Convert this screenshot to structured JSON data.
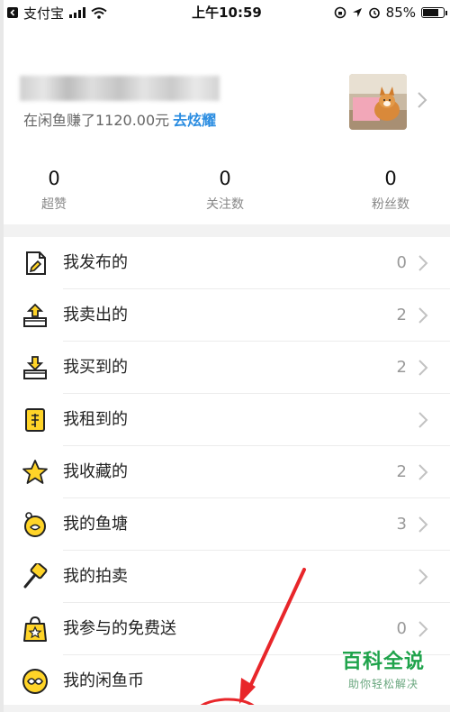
{
  "status_bar": {
    "app_back": "支付宝",
    "time": "上午10:59",
    "battery": "85%",
    "battery_level": 0.85
  },
  "profile": {
    "earnings_text": "在闲鱼赚了1120.00元",
    "earnings_link": "去炫耀"
  },
  "stats": [
    {
      "value": "0",
      "label": "超赞"
    },
    {
      "value": "0",
      "label": "关注数"
    },
    {
      "value": "0",
      "label": "粉丝数"
    }
  ],
  "menu": [
    {
      "label": "我发布的",
      "count": "0",
      "icon": "document-pen-icon"
    },
    {
      "label": "我卖出的",
      "count": "2",
      "icon": "box-upload-icon"
    },
    {
      "label": "我买到的",
      "count": "2",
      "icon": "box-download-icon"
    },
    {
      "label": "我租到的",
      "count": "",
      "icon": "rent-tag-icon"
    },
    {
      "label": "我收藏的",
      "count": "2",
      "icon": "star-icon"
    },
    {
      "label": "我的鱼塘",
      "count": "3",
      "icon": "pond-icon"
    },
    {
      "label": "我的拍卖",
      "count": "",
      "icon": "auction-hammer-icon"
    },
    {
      "label": "我参与的免费送",
      "count": "0",
      "icon": "gift-bag-icon"
    },
    {
      "label": "我的闲鱼币",
      "count": "",
      "icon": "coin-icon"
    }
  ],
  "watermark": {
    "title": "百科全说",
    "subtitle": "助你轻松解决"
  },
  "colors": {
    "accent_link": "#2b8de1",
    "icon_yellow": "#ffd428",
    "annotation_red": "#e8262a",
    "watermark_green": "#1fa34b"
  }
}
